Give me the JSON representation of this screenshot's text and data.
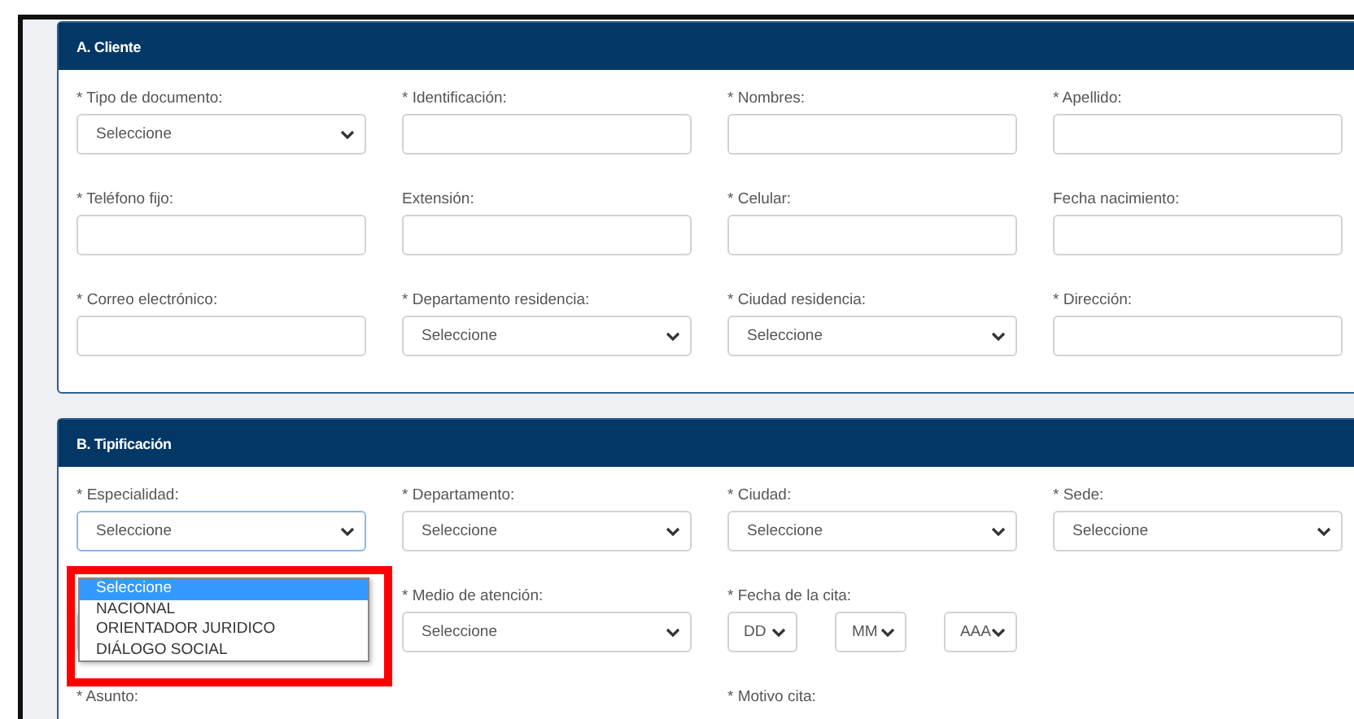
{
  "sections": [
    {
      "title": "A. Cliente",
      "rows": [
        [
          {
            "kind": "select",
            "label": "* Tipo de documento:",
            "value": "Seleccione"
          },
          {
            "kind": "text",
            "label": "* Identificación:"
          },
          {
            "kind": "text",
            "label": "* Nombres:"
          },
          {
            "kind": "text",
            "label": "* Apellido:"
          }
        ],
        [
          {
            "kind": "text",
            "label": "* Teléfono fijo:"
          },
          {
            "kind": "text",
            "label": "Extensión:"
          },
          {
            "kind": "text",
            "label": "* Celular:"
          },
          {
            "kind": "text",
            "label": "Fecha nacimiento:"
          }
        ],
        [
          {
            "kind": "text",
            "label": "* Correo electrónico:"
          },
          {
            "kind": "select",
            "label": "* Departamento residencia:",
            "value": "Seleccione"
          },
          {
            "kind": "select",
            "label": "* Ciudad residencia:",
            "value": "Seleccione"
          },
          {
            "kind": "text",
            "label": "* Dirección:"
          }
        ]
      ]
    },
    {
      "title": "B. Tipificación",
      "rows": [
        [
          {
            "kind": "select",
            "label": "* Especialidad:",
            "value": "Seleccione",
            "open": true,
            "options": [
              {
                "label": "Seleccione",
                "selected": true
              },
              {
                "label": "NACIONAL",
                "selected": false
              },
              {
                "label": "ORIENTADOR JURIDICO",
                "selected": false
              },
              {
                "label": "DIÁLOGO SOCIAL",
                "selected": false
              }
            ]
          },
          {
            "kind": "select",
            "label": "* Departamento:",
            "value": "Seleccione"
          },
          {
            "kind": "select",
            "label": "* Ciudad:",
            "value": "Seleccione"
          },
          {
            "kind": "select",
            "label": "* Sede:",
            "value": "Seleccione"
          }
        ],
        [
          {
            "kind": "select"
          },
          {
            "kind": "select",
            "label": "* Medio de atención:",
            "value": "Seleccione"
          },
          {
            "kind": "date",
            "label": "* Fecha de la cita:",
            "parts": [
              "DD",
              "MM",
              "AAA"
            ]
          },
          null
        ],
        [
          {
            "kind": "label",
            "label": "* Asunto:"
          },
          null,
          {
            "kind": "label",
            "label": "* Motivo cita:"
          },
          null
        ]
      ]
    }
  ]
}
